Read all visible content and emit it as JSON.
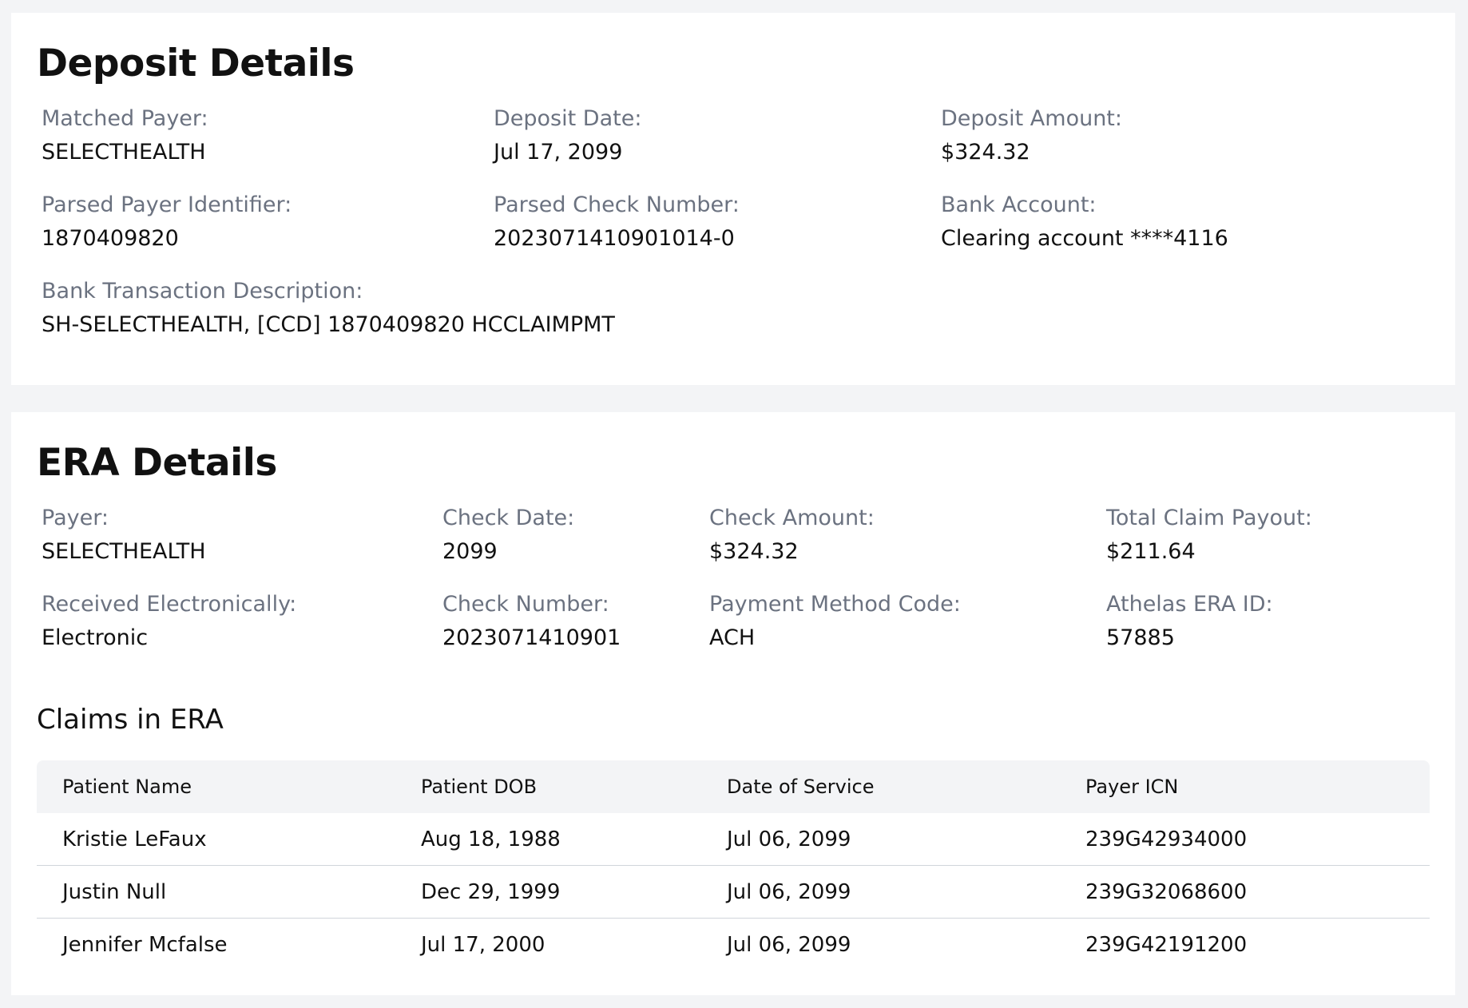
{
  "deposit": {
    "title": "Deposit Details",
    "fields": [
      {
        "label": "Matched Payer:",
        "value": "SELECTHEALTH"
      },
      {
        "label": "Deposit Date:",
        "value": "Jul 17, 2099"
      },
      {
        "label": "Deposit Amount:",
        "value": "$324.32"
      },
      {
        "label": "Parsed Payer Identifier:",
        "value": "1870409820"
      },
      {
        "label": "Parsed Check Number:",
        "value": "2023071410901014-0"
      },
      {
        "label": "Bank Account:",
        "value": "Clearing account ****4116"
      },
      {
        "label": "Bank Transaction Description:",
        "value": "SH-SELECTHEALTH, [CCD] 1870409820 HCCLAIMPMT"
      }
    ]
  },
  "era": {
    "title": "ERA Details",
    "fields": [
      {
        "label": "Payer:",
        "value": "SELECTHEALTH"
      },
      {
        "label": "Check Date:",
        "value": "2099"
      },
      {
        "label": "Check Amount:",
        "value": "$324.32"
      },
      {
        "label": "Total Claim Payout:",
        "value": "$211.64"
      },
      {
        "label": "Received Electronically:",
        "value": "Electronic"
      },
      {
        "label": "Check Number:",
        "value": "2023071410901"
      },
      {
        "label": "Payment Method Code:",
        "value": "ACH"
      },
      {
        "label": "Athelas ERA ID:",
        "value": "57885"
      }
    ],
    "claims": {
      "title": "Claims in ERA",
      "columns": [
        "Patient Name",
        "Patient DOB",
        "Date of Service",
        "Payer ICN"
      ],
      "rows": [
        [
          "Kristie LeFaux",
          "Aug 18, 1988",
          "Jul 06, 2099",
          "239G42934000"
        ],
        [
          "Justin Null",
          "Dec 29, 1999",
          "Jul 06, 2099",
          "239G32068600"
        ],
        [
          "Jennifer Mcfalse",
          "Jul 17, 2000",
          "Jul 06, 2099",
          "239G42191200"
        ]
      ]
    }
  }
}
